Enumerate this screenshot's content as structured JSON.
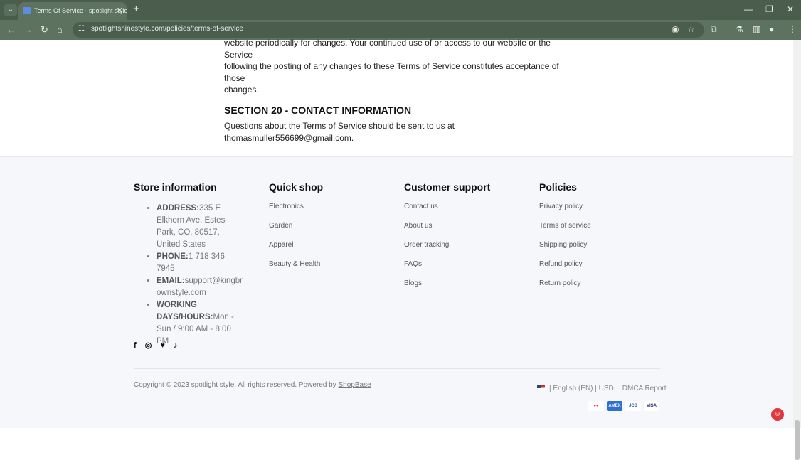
{
  "browser": {
    "tab_title": "Terms Of Service - spotlight style",
    "url": "spotlightshinestyle.com/policies/terms-of-service"
  },
  "content": {
    "para_lines": [
      "website periodically for changes. Your continued use of or access to our website or the Service",
      "following the posting of any changes to these Terms of Service constitutes acceptance of those",
      "changes."
    ],
    "section_title": "SECTION 20 - CONTACT INFORMATION",
    "contact_text": "Questions about the Terms of Service should be sent to us at thomasmuller556699@gmail.com."
  },
  "footer": {
    "store": {
      "title": "Store information",
      "items": [
        {
          "label": "ADDRESS:",
          "value": "335 E Elkhorn Ave, Estes Park, CO, 80517, United States"
        },
        {
          "label": "PHONE:",
          "value": "1 718 346 7945"
        },
        {
          "label": "EMAIL:",
          "value": "support@kingbrownstyle.com"
        },
        {
          "label": "WORKING DAYS/HOURS:",
          "value": "Mon - Sun / 9:00 AM - 8:00 PM"
        }
      ]
    },
    "quick_shop": {
      "title": "Quick shop",
      "links": [
        "Electronics",
        "Garden",
        "Apparel",
        "Beauty & Health"
      ]
    },
    "support": {
      "title": "Customer support",
      "links": [
        "Contact us",
        "About us",
        "Order tracking",
        "FAQs",
        "Blogs"
      ]
    },
    "policies": {
      "title": "Policies",
      "links": [
        "Privacy policy",
        "Terms of service",
        "Shipping policy",
        "Refund policy",
        "Return policy"
      ]
    },
    "social": {
      "facebook": "f",
      "instagram": "◎",
      "twitter": "🐦",
      "tiktok": "♪"
    },
    "copyright": "Copyright © 2023 spotlight style. All rights reserved. Powered by ",
    "powered_by": "ShopBase",
    "locale": "| English (EN) | USD",
    "dmca": "DMCA Report",
    "payments": [
      "Mastercard",
      "AMEX",
      "JCB",
      "VISA"
    ]
  }
}
